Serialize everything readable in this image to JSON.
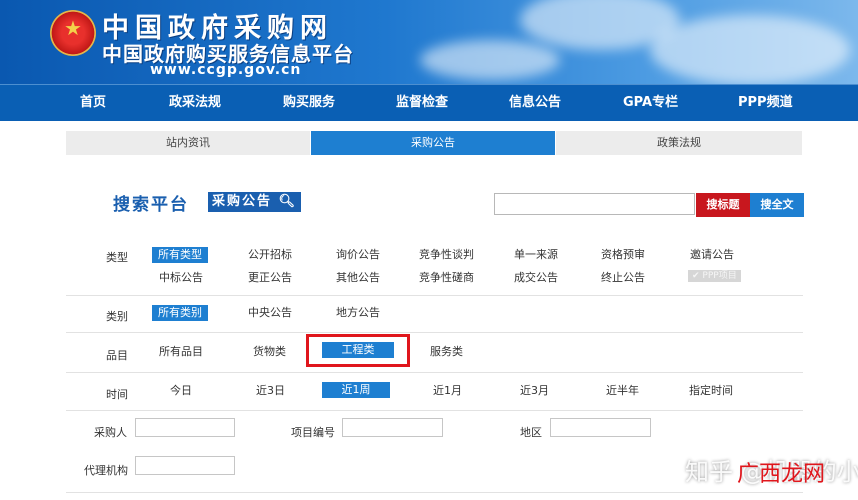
{
  "header": {
    "title": "中国政府采购网",
    "subtitle": "中国政府购买服务信息平台",
    "url": "www.ccgp.gov.cn"
  },
  "nav": {
    "items": [
      "首页",
      "政采法规",
      "购买服务",
      "监督检查",
      "信息公告",
      "GPA专栏",
      "PPP频道"
    ]
  },
  "subtabs": [
    "站内资讯",
    "采购公告",
    "政策法规"
  ],
  "search": {
    "logo_text": "搜索平台",
    "logo_box": "采购公告",
    "input_value": "",
    "btn_title": "搜标题",
    "btn_full": "搜全文"
  },
  "filters": {
    "type_label": "类型",
    "type_options_row1": [
      "所有类型",
      "公开招标",
      "询价公告",
      "竞争性谈判",
      "单一来源",
      "资格预审",
      "邀请公告"
    ],
    "type_options_row2": [
      "中标公告",
      "更正公告",
      "其他公告",
      "竞争性磋商",
      "成交公告",
      "终止公告",
      "PPP项目"
    ],
    "category_label": "类别",
    "category_options": [
      "所有类别",
      "中央公告",
      "地方公告"
    ],
    "item_label": "品目",
    "item_options": [
      "所有品目",
      "货物类",
      "工程类",
      "服务类"
    ],
    "time_label": "时间",
    "time_options": [
      "今日",
      "近3日",
      "近1周",
      "近1月",
      "近3月",
      "近半年",
      "指定时间"
    ],
    "purchaser_label": "采购人",
    "project_no_label": "项目编号",
    "region_label": "地区",
    "agency_label": "代理机构"
  },
  "watermark": {
    "text": "知乎 @机器的小标",
    "overlay": "广西龙网"
  },
  "colors": {
    "brand_blue": "#0a5fb4",
    "accent_blue": "#1e7fd1",
    "accent_red": "#c8171e",
    "highlight_red": "#e0161c"
  }
}
